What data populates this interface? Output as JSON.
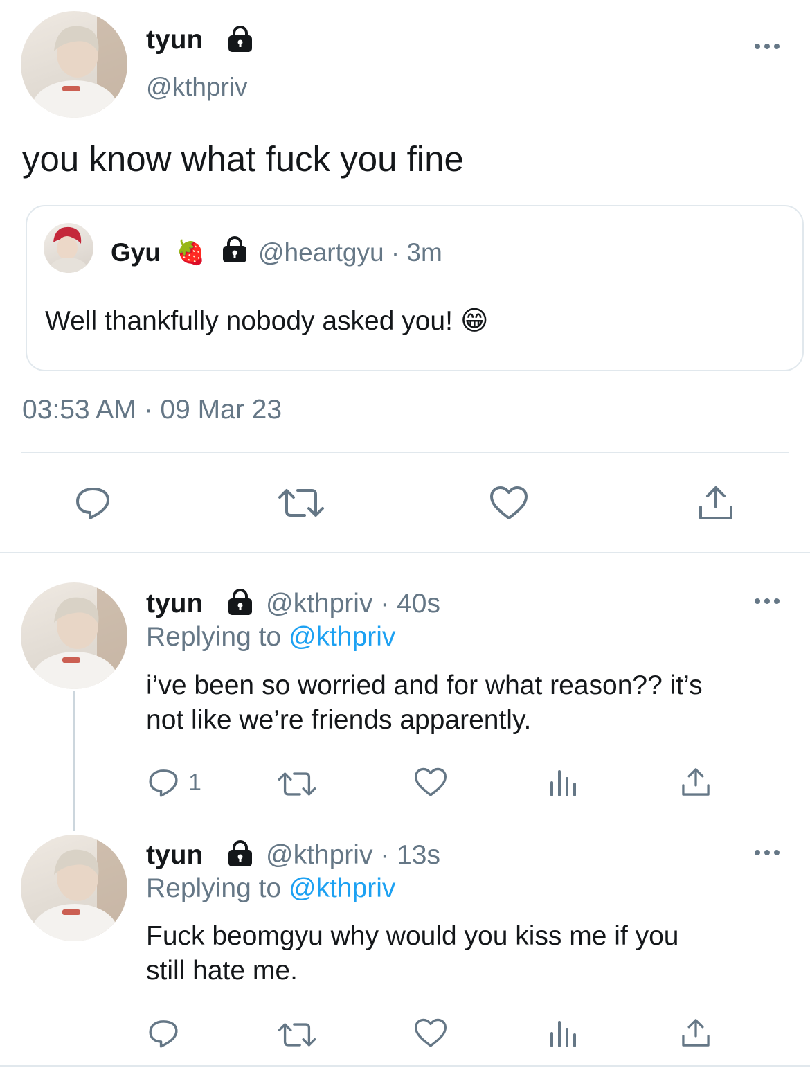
{
  "main_tweet": {
    "display_name": "tyun",
    "handle": "@kthpriv",
    "text": "you know what fuck you fine",
    "timestamp": "03:53 AM · 09 Mar 23",
    "more_icon": "more-horizontal-icon"
  },
  "quoted_tweet": {
    "display_name": "Gyu",
    "emoji": "🍓",
    "handle_time": "@heartgyu · 3m",
    "text": "Well thankfully nobody asked you!",
    "text_emoji": "😁"
  },
  "main_actions": {
    "icons": [
      "reply-icon",
      "retweet-icon",
      "like-icon",
      "share-icon"
    ]
  },
  "replies": [
    {
      "display_name": "tyun",
      "handle_time": "@kthpriv · 40s",
      "replying_prefix": "Replying to",
      "replying_handle": "@kthpriv",
      "text_line1": "i’ve been so worried and for what reason?? it’s",
      "text_line2": "not like we’re friends apparently.",
      "reply_count": "1"
    },
    {
      "display_name": "tyun",
      "handle_time": "@kthpriv · 13s",
      "replying_prefix": "Replying to",
      "replying_handle": "@kthpriv",
      "text_line1": "Fuck beomgyu why would you kiss me if you",
      "text_line2": "still hate me.",
      "reply_count": ""
    }
  ],
  "colors": {
    "text": "#14171a",
    "muted": "#657786",
    "link": "#1da1f2",
    "divider": "#e1e8ed"
  }
}
